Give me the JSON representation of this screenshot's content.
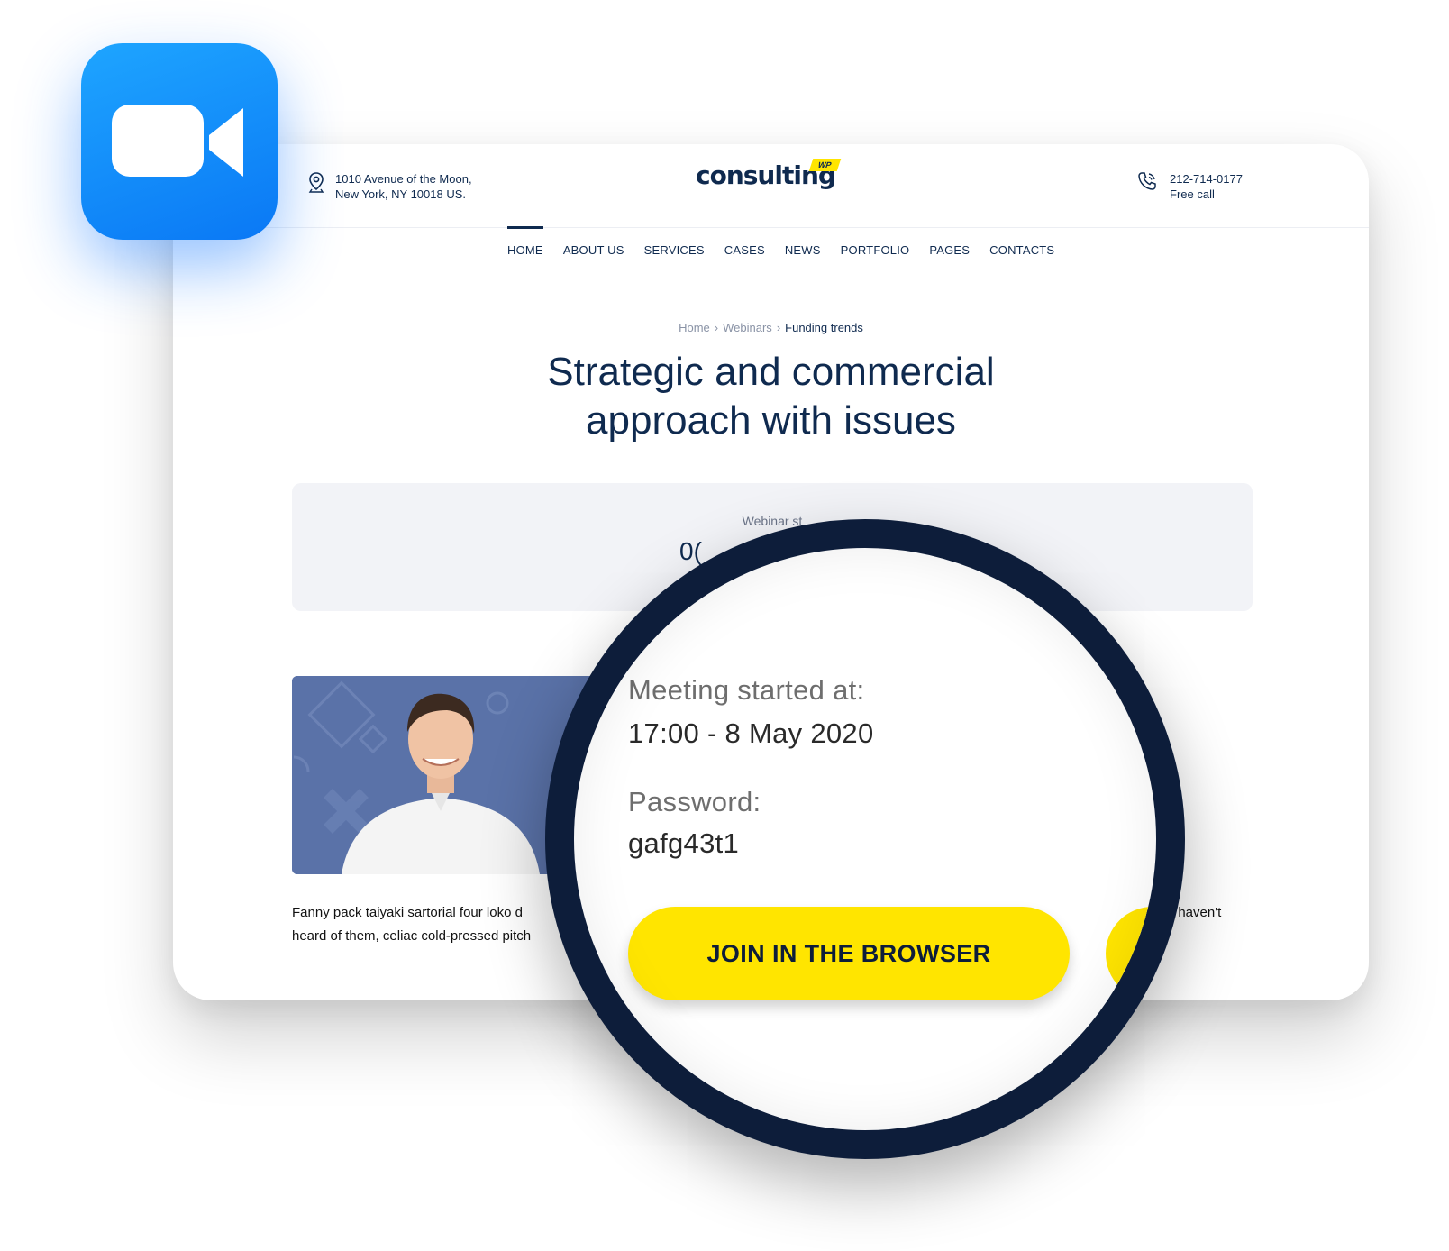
{
  "header": {
    "address_line1": "1010 Avenue of the Moon,",
    "address_line2": "New York, NY 10018 US.",
    "logo_text": "consulting",
    "logo_badge": "WP",
    "phone": "212-714-0177",
    "phone_note": "Free call"
  },
  "nav": {
    "items": [
      {
        "label": "HOME",
        "active": true
      },
      {
        "label": "ABOUT US"
      },
      {
        "label": "SERVICES"
      },
      {
        "label": "CASES"
      },
      {
        "label": "NEWS"
      },
      {
        "label": "PORTFOLIO"
      },
      {
        "label": "PAGES"
      },
      {
        "label": "CONTACTS"
      }
    ]
  },
  "breadcrumb": {
    "home": "Home",
    "section": "Webinars",
    "current": "Funding trends"
  },
  "page": {
    "title_line1": "Strategic and commercial",
    "title_line2": "approach with issues"
  },
  "panel": {
    "label": "Webinar st",
    "value": "0("
  },
  "body_text": {
    "line1_start": "Fanny pack taiyaki sartorial four loko d",
    "line1_end": "bly haven't",
    "line2_start": "heard of them, celiac cold-pressed pitch"
  },
  "meeting": {
    "started_label": "Meeting started at:",
    "started_value": "17:00 - 8 May 2020",
    "password_label": "Password:",
    "password_value": "gafg43t1",
    "join_button": "JOIN IN THE BROWSER"
  },
  "colors": {
    "navy": "#0f2a4f",
    "accent_yellow": "#ffe500",
    "zoom_blue": "#0a78f5"
  },
  "icons": {
    "app": "video-camera-icon",
    "address": "location-pin-icon",
    "phone": "phone-icon",
    "breadcrumb_separator": "chevron-right-icon"
  }
}
